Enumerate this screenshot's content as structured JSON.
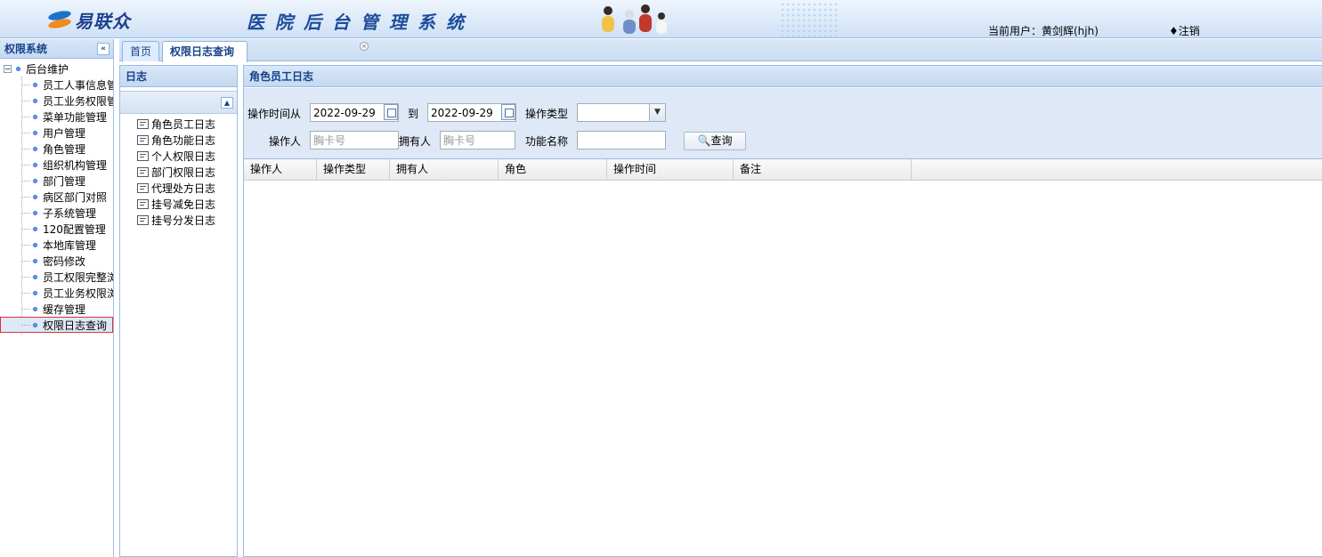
{
  "header": {
    "logo_text": "易联众",
    "system_title": "医院后台管理系统",
    "current_user": "当前用户：黄剑辉(hjh)",
    "logout": "♦注销"
  },
  "sidebar": {
    "title": "权限系统",
    "collapse_icon": "«",
    "root": "后台维护",
    "items": [
      "员工人事信息管",
      "员工业务权限管",
      "菜单功能管理",
      "用户管理",
      "角色管理",
      "组织机构管理",
      "部门管理",
      "病区部门对照",
      "子系统管理",
      "120配置管理",
      "本地库管理",
      "密码修改",
      "员工权限完整浏",
      "员工业务权限浏",
      "缓存管理",
      "权限日志查询"
    ],
    "selected": "权限日志查询"
  },
  "tabs": {
    "home": "首页",
    "active": "权限日志查询",
    "close_icon": "×"
  },
  "log_panel": {
    "title": "日志",
    "items": [
      "角色员工日志",
      "角色功能日志",
      "个人权限日志",
      "部门权限日志",
      "代理处方日志",
      "挂号减免日志",
      "挂号分发日志"
    ]
  },
  "main": {
    "title": "角色员工日志",
    "search": {
      "time_from_label": "操作时间从",
      "date_from": "2022-09-29",
      "to_label": "到",
      "date_to": "2022-09-29",
      "op_type_label": "操作类型",
      "op_type_value": "",
      "operator_label": "操作人",
      "operator_placeholder": "胸卡号",
      "owner_label": "拥有人",
      "owner_placeholder": "胸卡号",
      "func_label": "功能名称",
      "func_value": "",
      "query_button": "查询"
    },
    "grid_columns": [
      "操作人",
      "操作类型",
      "拥有人",
      "角色",
      "操作时间",
      "备注"
    ]
  }
}
